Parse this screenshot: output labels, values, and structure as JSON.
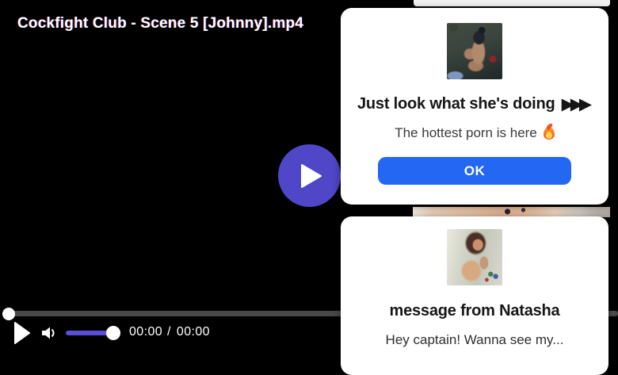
{
  "colors": {
    "accent": "#4f46c8",
    "volume_fill": "#5b4fd9",
    "seek_track": "#484848",
    "ok_blue": "#2367f2",
    "page_background": "#000000",
    "card_background": "#ffffff"
  },
  "player": {
    "title": "Cockfight Club - Scene 5 [Johnny].mp4",
    "controls": {
      "current_time": "00:00",
      "separator": "/",
      "duration": "00:00"
    },
    "icons": {
      "big_play": "play-triangle",
      "play": "play-triangle",
      "volume": "speaker-with-wave"
    }
  },
  "overlays": {
    "ad_card_1": {
      "thumbnail": "webcam-couple-photo",
      "heading": "Just look what she's doing",
      "heading_arrows": "▶▶▶",
      "subtext": "The hottest porn is here",
      "subtext_icon": "fire",
      "ok_label": "OK"
    },
    "ad_card_2": {
      "thumbnail": "natasha-mirror-selfie-photo",
      "heading": "message from Natasha",
      "message": "Hey captain! Wanna see my..."
    }
  }
}
